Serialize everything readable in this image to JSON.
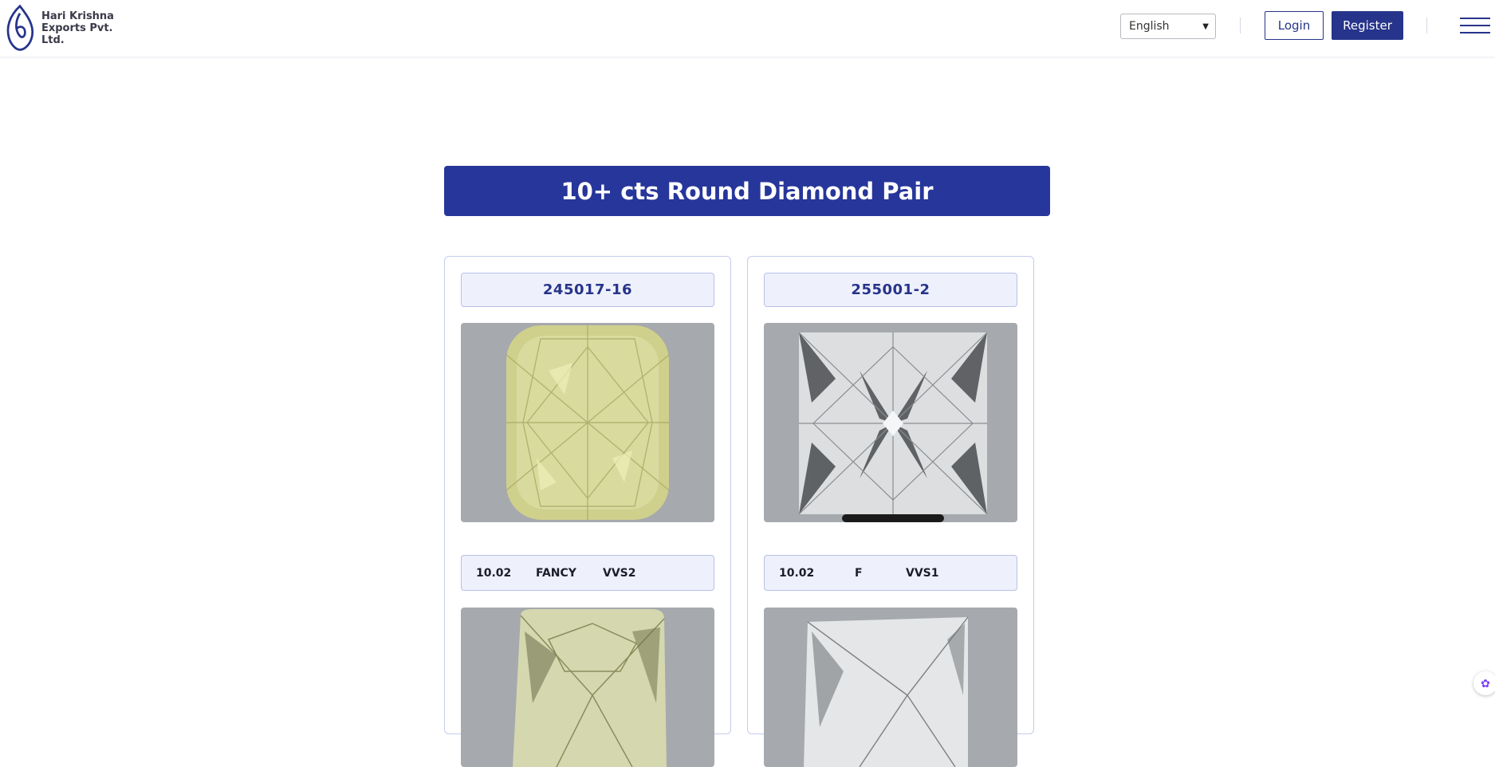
{
  "header": {
    "logo_line1": "Hari Krishna",
    "logo_line2": "Exports Pvt. Ltd.",
    "language": "English",
    "login_label": "Login",
    "register_label": "Register",
    "menu_icon": "hamburger-menu-icon"
  },
  "banner": {
    "title": "10+ cts Round Diamond Pair"
  },
  "cards": [
    {
      "id": "245017-16",
      "carat": "10.02",
      "color": "FANCY",
      "clarity": "VVS2",
      "stone_tone": "#d8d99a"
    },
    {
      "id": "255001-2",
      "carat": "10.02",
      "color": "F",
      "clarity": "VVS1",
      "stone_tone": "#e4e6e8"
    }
  ],
  "colors": {
    "brand": "#27348b",
    "banner": "#27369a",
    "image_bg": "#a6a9ad"
  }
}
